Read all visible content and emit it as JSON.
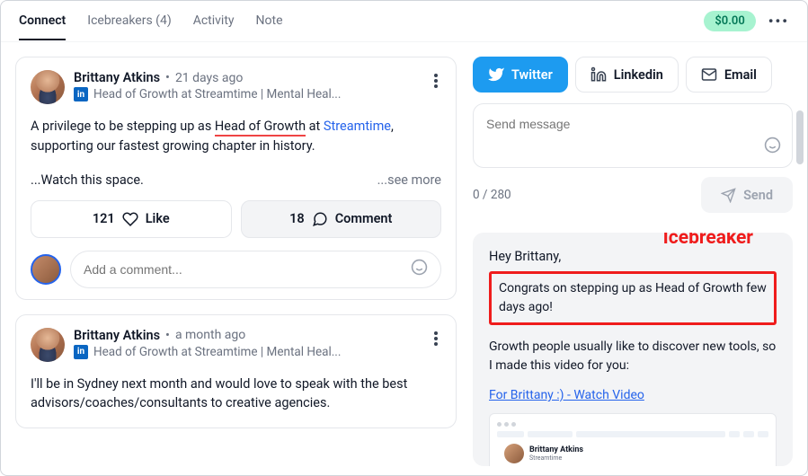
{
  "topbar": {
    "tabs": {
      "connect": "Connect",
      "icebreakers": "Icebreakers (4)",
      "activity": "Activity",
      "note": "Note"
    },
    "money": "$0.00"
  },
  "posts": [
    {
      "name": "Brittany Atkins",
      "ago": "21 days ago",
      "subtitle": "Head of Growth at Streamtime | Mental Heal...",
      "body_pre": "A privilege to be stepping up as ",
      "body_hl": "Head of Growth",
      "body_mid": " at ",
      "body_link": "Streamtime",
      "body_post": ", supporting our fastest growing chapter in history.",
      "watch": "...Watch this space.",
      "see_more": "...see more",
      "likes": "121",
      "like_label": "Like",
      "comments": "18",
      "comment_label": "Comment",
      "comment_placeholder": "Add a comment..."
    },
    {
      "name": "Brittany Atkins",
      "ago": "a month ago",
      "subtitle": "Head of Growth at Streamtime | Mental Heal...",
      "body": "I'll be in Sydney next month and would love to speak with the best advisors/coaches/consultants to creative agencies."
    }
  ],
  "compose": {
    "channels": {
      "twitter": "Twitter",
      "linkedin": "Linkedin",
      "email": "Email"
    },
    "placeholder": "Send message",
    "count": "0 / 280",
    "send": "Send"
  },
  "preview": {
    "label": "Icebreaker",
    "greet": "Hey Brittany,",
    "congrats": "Congrats on stepping up as Head of Growth few days ago!",
    "body": "Growth people usually like to discover new tools, so I made this video for you:",
    "link": "For Brittany :) - Watch Video",
    "thumb_name": "Brittany Atkins",
    "thumb_sub": "Streamtime"
  }
}
